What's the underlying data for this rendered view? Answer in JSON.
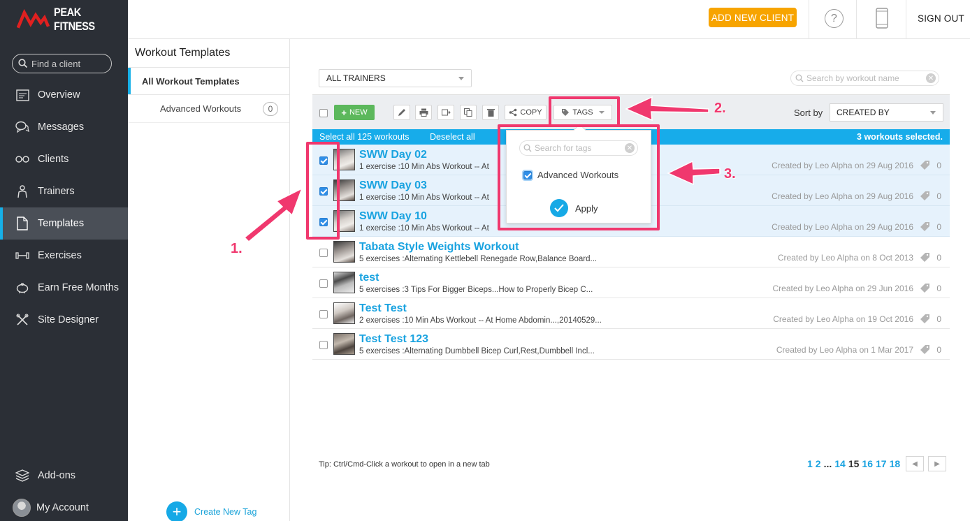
{
  "app": {
    "brand": "PEAK FITNESS",
    "accent": "#16b0e8"
  },
  "sidebar": {
    "search_placeholder": "Find a client",
    "items": [
      {
        "label": "Overview",
        "icon": "overview-icon"
      },
      {
        "label": "Messages",
        "icon": "messages-icon"
      },
      {
        "label": "Clients",
        "icon": "clients-icon"
      },
      {
        "label": "Trainers",
        "icon": "trainers-icon"
      },
      {
        "label": "Templates",
        "icon": "templates-icon",
        "active": true
      },
      {
        "label": "Exercises",
        "icon": "dumbbell-icon"
      },
      {
        "label": "Earn Free Months",
        "icon": "piggy-bank-icon"
      },
      {
        "label": "Site Designer",
        "icon": "tools-icon"
      }
    ],
    "bottom": [
      {
        "label": "Add-ons",
        "icon": "layers-icon"
      },
      {
        "label": "My Account",
        "icon": "avatar"
      }
    ]
  },
  "topbar": {
    "add_client": "ADD NEW CLIENT",
    "help": "?",
    "sign_out": "SIGN OUT"
  },
  "panel": {
    "title": "Workout Templates",
    "all_label": "All Workout Templates",
    "tag_label": "Advanced Workouts",
    "tag_count": "0",
    "create_tag": "Create New Tag"
  },
  "filters": {
    "trainer": "ALL TRAINERS",
    "search_placeholder": "Search by workout name"
  },
  "toolbar": {
    "new": "NEW",
    "copy": "COPY",
    "tags": "TAGS",
    "sort_label": "Sort by",
    "sort_value": "CREATED BY"
  },
  "selection": {
    "select_all": "Select all 125 workouts",
    "deselect_all": "Deselect all",
    "selected": "3 workouts selected."
  },
  "tags_dropdown": {
    "search_placeholder": "Search for tags",
    "option": "Advanced Workouts",
    "apply": "Apply"
  },
  "workouts": [
    {
      "title": "SWW Day 02",
      "sub": "1 exercise :10 Min Abs Workout -- At",
      "created": "Created by Leo Alpha on 29 Aug 2016",
      "tags": "0",
      "selected": true
    },
    {
      "title": "SWW Day 03",
      "sub": "1 exercise :10 Min Abs Workout -- At",
      "created": "Created by Leo Alpha on 29 Aug 2016",
      "tags": "0",
      "selected": true
    },
    {
      "title": "SWW Day 10",
      "sub": "1 exercise :10 Min Abs Workout -- At",
      "created": "Created by Leo Alpha on 29 Aug 2016",
      "tags": "0",
      "selected": true
    },
    {
      "title": "Tabata Style Weights Workout",
      "sub": "5 exercises :Alternating Kettlebell Renegade Row,Balance Board...",
      "created": "Created by Leo Alpha on 8 Oct 2013",
      "tags": "0",
      "selected": false
    },
    {
      "title": "test",
      "sub": "5 exercises :3 Tips For Bigger Biceps...How to Properly Bicep C...",
      "created": "Created by Leo Alpha on 29 Jun 2016",
      "tags": "0",
      "selected": false
    },
    {
      "title": "Test Test",
      "sub": "2 exercises :10 Min Abs Workout -- At Home Abdomin...,20140529...",
      "created": "Created by Leo Alpha on 19 Oct 2016",
      "tags": "0",
      "selected": false
    },
    {
      "title": "Test Test 123",
      "sub": "5 exercises :Alternating Dumbbell Bicep Curl,Rest,Dumbbell Incl...",
      "created": "Created by Leo Alpha on 1 Mar 2017",
      "tags": "0",
      "selected": false
    }
  ],
  "footer": {
    "tip": "Tip: Ctrl/Cmd-Click a workout to open in a new tab",
    "pages": [
      "1",
      "2",
      "...",
      "14",
      "15",
      "16",
      "17",
      "18"
    ],
    "current_page": "15"
  },
  "annotations": {
    "one": "1.",
    "two": "2.",
    "three": "3.",
    "color": "#f0386e"
  }
}
